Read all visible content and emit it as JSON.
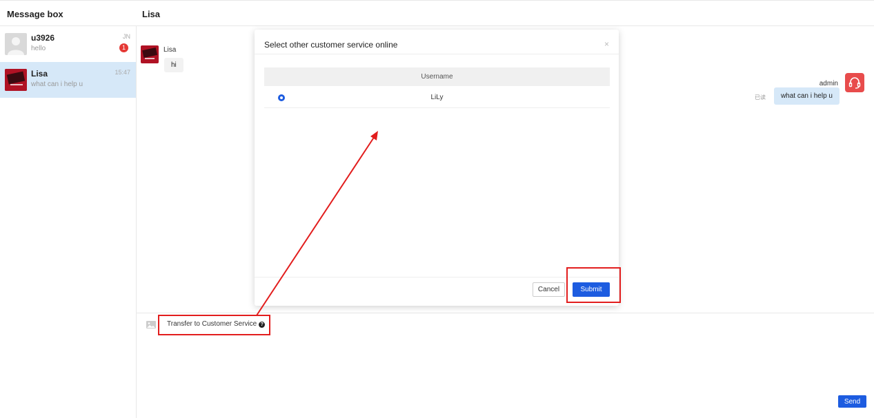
{
  "header": {
    "left_title": "Message box",
    "right_title": "Lisa"
  },
  "conversations": [
    {
      "name": "u3926",
      "snippet": "hello",
      "time": "JN",
      "badge": "1"
    },
    {
      "name": "Lisa",
      "snippet": "what can i help u",
      "time": "15:47",
      "badge": ""
    }
  ],
  "chat": {
    "left_message": {
      "sender": "Lisa",
      "text": "hi"
    },
    "right_message": {
      "sender": "admin",
      "text": "what can i help u",
      "status": "已读"
    }
  },
  "composer": {
    "transfer_label": "Transfer to Customer Service",
    "send_label": "Send"
  },
  "modal": {
    "title": "Select other customer service online",
    "close_symbol": "×",
    "column_header": "Username",
    "rows": [
      {
        "username": "LiLy",
        "selected": true
      }
    ],
    "cancel_label": "Cancel",
    "submit_label": "Submit"
  },
  "colors": {
    "primary": "#1d5ce0",
    "active_item": "#d6e8f8",
    "badge": "#e53935",
    "annotation": "#e21d1d"
  }
}
